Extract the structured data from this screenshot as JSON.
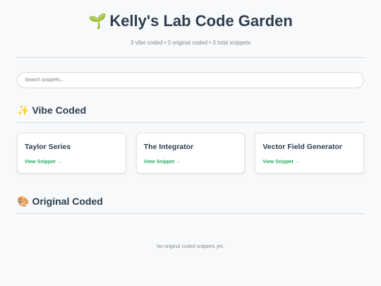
{
  "header": {
    "title_emoji": "🌱",
    "title": "Kelly's Lab Code Garden",
    "stats": "3 vibe coded • 0 original coded • 3 total snippets"
  },
  "search": {
    "placeholder": "Search snippets...",
    "value": ""
  },
  "sections": {
    "vibe": {
      "emoji": "✨",
      "title": "Vibe Coded",
      "cards": [
        {
          "title": "Taylor Series",
          "link": "View Snippet →"
        },
        {
          "title": "The Integrator",
          "link": "View Snippet →"
        },
        {
          "title": "Vector Field Generator",
          "link": "View Snippet →"
        }
      ]
    },
    "original": {
      "emoji": "🎨",
      "title": "Original Coded",
      "empty_message": "No original coded snippets yet."
    }
  },
  "colors": {
    "background": "#f8f9fa",
    "heading": "#2c3e50",
    "muted": "#7f8c8d",
    "link_accent": "#27ae60",
    "card_border": "#dfe3e7"
  }
}
